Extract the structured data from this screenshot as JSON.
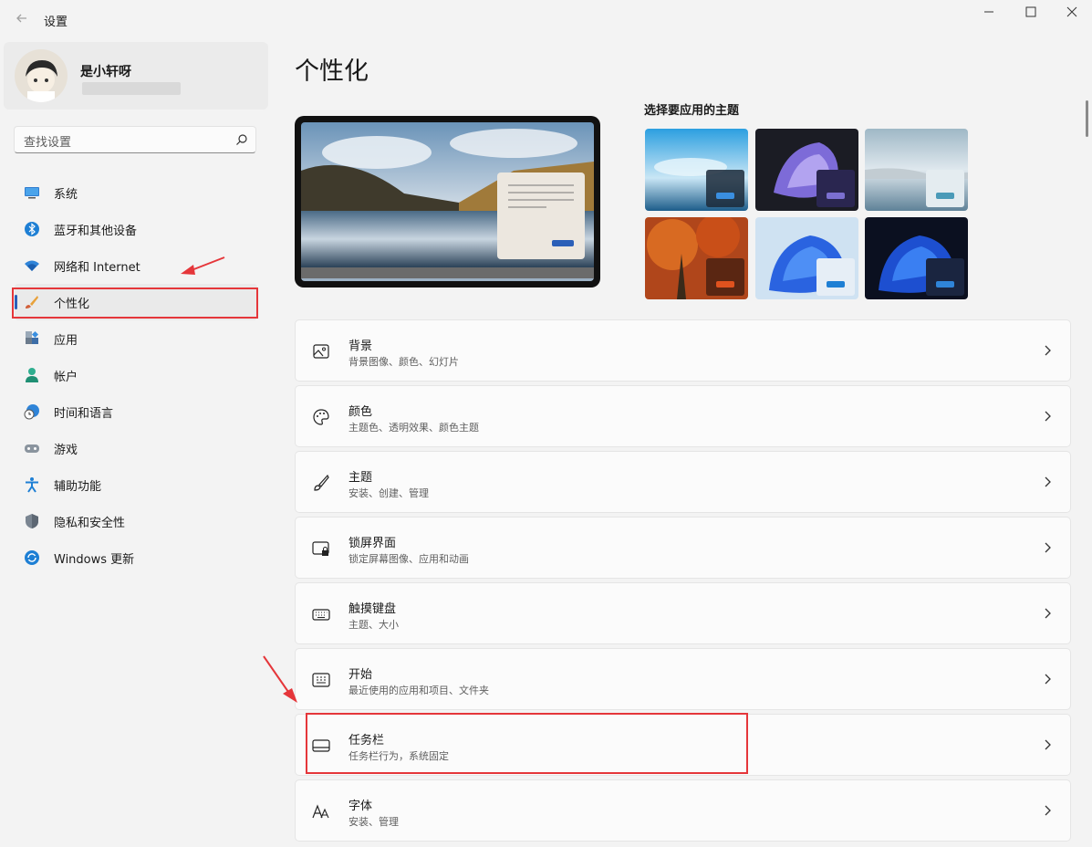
{
  "app": {
    "title": "设置"
  },
  "profile": {
    "name": "是小轩呀"
  },
  "search": {
    "placeholder": "查找设置"
  },
  "sidebar": {
    "items": [
      {
        "label": "系统",
        "icon": "monitor-icon"
      },
      {
        "label": "蓝牙和其他设备",
        "icon": "bluetooth-icon"
      },
      {
        "label": "网络和 Internet",
        "icon": "wifi-icon"
      },
      {
        "label": "个性化",
        "icon": "brush-icon",
        "active": true
      },
      {
        "label": "应用",
        "icon": "apps-icon"
      },
      {
        "label": "帐户",
        "icon": "person-icon"
      },
      {
        "label": "时间和语言",
        "icon": "clock-globe-icon"
      },
      {
        "label": "游戏",
        "icon": "gamepad-icon"
      },
      {
        "label": "辅助功能",
        "icon": "accessibility-icon"
      },
      {
        "label": "隐私和安全性",
        "icon": "shield-icon"
      },
      {
        "label": "Windows 更新",
        "icon": "update-icon"
      }
    ]
  },
  "main": {
    "title": "个性化",
    "theme_label": "选择要应用的主题",
    "rows": [
      {
        "title": "背景",
        "subtitle": "背景图像、颜色、幻灯片",
        "icon": "image-icon"
      },
      {
        "title": "颜色",
        "subtitle": "主题色、透明效果、颜色主题",
        "icon": "palette-icon"
      },
      {
        "title": "主题",
        "subtitle": "安装、创建、管理",
        "icon": "brush-icon"
      },
      {
        "title": "锁屏界面",
        "subtitle": "锁定屏幕图像、应用和动画",
        "icon": "lock-screen-icon"
      },
      {
        "title": "触摸键盘",
        "subtitle": "主题、大小",
        "icon": "keyboard-icon"
      },
      {
        "title": "开始",
        "subtitle": "最近使用的应用和项目、文件夹",
        "icon": "start-icon"
      },
      {
        "title": "任务栏",
        "subtitle": "任务栏行为，系统固定",
        "icon": "taskbar-icon"
      },
      {
        "title": "字体",
        "subtitle": "安装、管理",
        "icon": "font-icon"
      }
    ]
  },
  "colors": {
    "accent": "#2b5fb8",
    "annotation": "#e5363a"
  }
}
